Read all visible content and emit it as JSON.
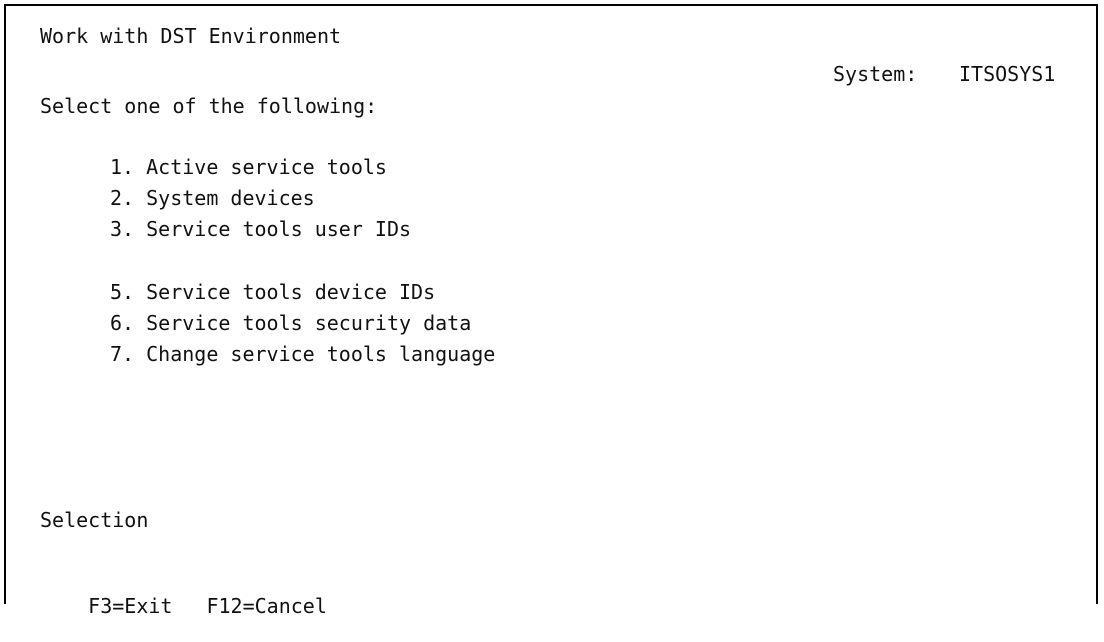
{
  "header": {
    "title": "Work with DST Environment",
    "system_label": "System:",
    "system_name": "ITSOSYS1"
  },
  "instruction": "Select one of the following:",
  "menu": {
    "items": [
      {
        "label": "1. Active service tools"
      },
      {
        "label": "2. System devices"
      },
      {
        "label": "3. Service tools user IDs"
      },
      {
        "label": "5. Service tools device IDs"
      },
      {
        "label": "6. Service tools security data"
      },
      {
        "label": "7. Change service tools language"
      }
    ]
  },
  "selection": {
    "label": "Selection",
    "value": ""
  },
  "function_keys": [
    {
      "label": "F3=Exit"
    },
    {
      "label": "F12=Cancel"
    }
  ]
}
